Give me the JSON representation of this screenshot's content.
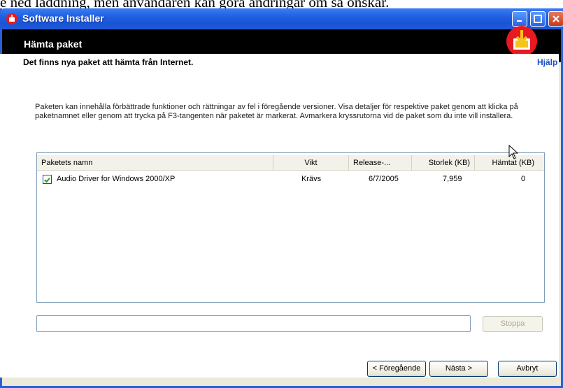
{
  "caption": "e ned laddning, men användaren kan göra ändringar om så önskar.",
  "window": {
    "title": "Software Installer",
    "header_title": "Hämta paket",
    "subtitle": "Det finns nya paket att hämta från Internet.",
    "help_link": "Hjälp"
  },
  "description": "Paketen kan innehålla förbättrade funktioner och rättningar av fel i föregående versioner. Visa detaljer för respektive paket genom att klicka på paketnamnet eller genom att trycka på F3-tangenten när paketet är markerat. Avmarkera kryssrutorna vid de paket som du inte vill installera.",
  "table": {
    "columns": [
      "Paketets namn",
      "Vikt",
      "Release-...",
      "Storlek (KB)",
      "Hämtat (KB)"
    ],
    "rows": [
      {
        "checked": true,
        "name": "Audio Driver for Windows 2000/XP",
        "weight": "Krävs",
        "release": "6/7/2005",
        "size": "7,959",
        "downloaded": "0"
      }
    ]
  },
  "progress": {
    "value": 0
  },
  "buttons": {
    "stop": "Stoppa",
    "prev": "< Föregående",
    "next": "Nästa >",
    "cancel": "Avbryt"
  },
  "colors": {
    "titlebar": "#1f5fe0",
    "header": "#000000",
    "accent_logo": "#e8191f",
    "link": "#1a4fc9"
  }
}
